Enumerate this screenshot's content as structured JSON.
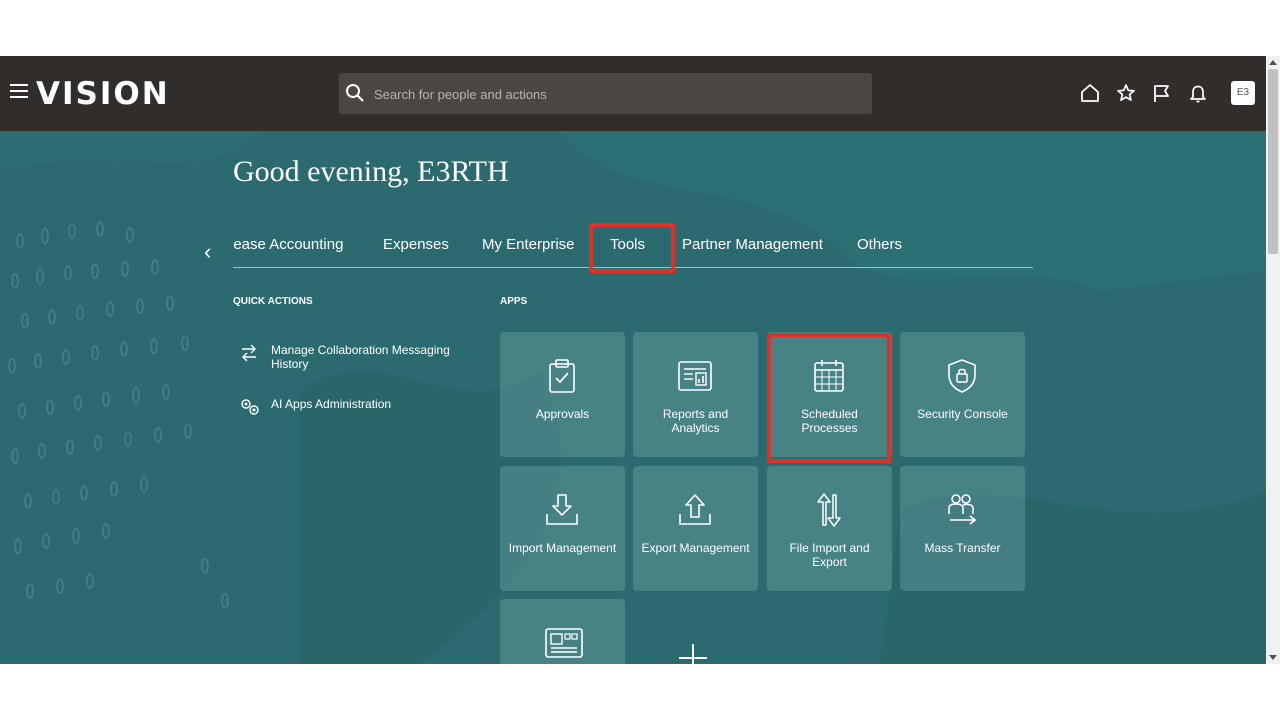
{
  "header": {
    "logo": "VISION",
    "search_placeholder": "Search for people and actions",
    "avatar": "E3",
    "icons": [
      "home-icon",
      "star-icon",
      "flag-icon",
      "bell-icon"
    ]
  },
  "hero": {
    "greeting": "Good evening, E3RTH"
  },
  "tabs": [
    {
      "label": "Lease Accounting"
    },
    {
      "label": "Expenses"
    },
    {
      "label": "My Enterprise"
    },
    {
      "label": "Tools",
      "selected": true
    },
    {
      "label": "Partner Management"
    },
    {
      "label": "Others"
    }
  ],
  "quick_actions": {
    "title": "QUICK ACTIONS",
    "items": [
      {
        "label": "Manage Collaboration Messaging History",
        "icon": "arrows-exchange-icon"
      },
      {
        "label": "AI Apps Administration",
        "icon": "gears-icon"
      }
    ]
  },
  "apps": {
    "title": "APPS",
    "items": [
      {
        "label": "Approvals",
        "icon": "clipboard-check-icon"
      },
      {
        "label": "Reports and Analytics",
        "icon": "report-chart-icon"
      },
      {
        "label": "Scheduled Processes",
        "icon": "calendar-icon"
      },
      {
        "label": "Security Console",
        "icon": "shield-lock-icon"
      },
      {
        "label": "Import Management",
        "icon": "import-icon"
      },
      {
        "label": "Export Management",
        "icon": "export-icon"
      },
      {
        "label": "File Import and Export",
        "icon": "up-down-arrows-icon"
      },
      {
        "label": "Mass Transfer",
        "icon": "people-transfer-icon"
      },
      {
        "label": "",
        "icon": "dashboard-panel-icon"
      }
    ],
    "add_icon": "plus-icon"
  },
  "colors": {
    "topbar": "#312d2a",
    "hero": "#2b6a6e",
    "highlight": "#e0302c"
  }
}
